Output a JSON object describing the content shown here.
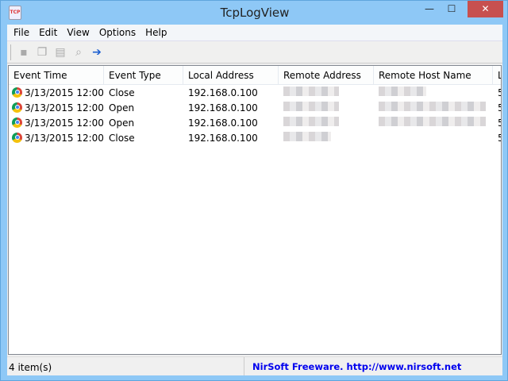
{
  "window": {
    "title": "TcpLogView",
    "minimize": "—",
    "maximize": "☐",
    "close": "✕"
  },
  "menu": [
    "File",
    "Edit",
    "View",
    "Options",
    "Help"
  ],
  "toolbar": [
    "save-icon",
    "copy-icon",
    "properties-icon",
    "find-icon",
    "exit-icon"
  ],
  "columns": [
    "Event Time",
    "Event Type",
    "Local Address",
    "Remote Address",
    "Remote Host Name",
    "L"
  ],
  "rows": [
    {
      "time": "3/13/2015 12:00:...",
      "type": "Close",
      "local": "192.168.0.100",
      "last": "5"
    },
    {
      "time": "3/13/2015 12:00:...",
      "type": "Open",
      "local": "192.168.0.100",
      "last": "5"
    },
    {
      "time": "3/13/2015 12:00:...",
      "type": "Open",
      "local": "192.168.0.100",
      "last": "5"
    },
    {
      "time": "3/13/2015 12:00:...",
      "type": "Close",
      "local": "192.168.0.100",
      "last": "5"
    }
  ],
  "status": {
    "items": "4 item(s)",
    "credit": "NirSoft Freeware.  http://www.nirsoft.net"
  }
}
